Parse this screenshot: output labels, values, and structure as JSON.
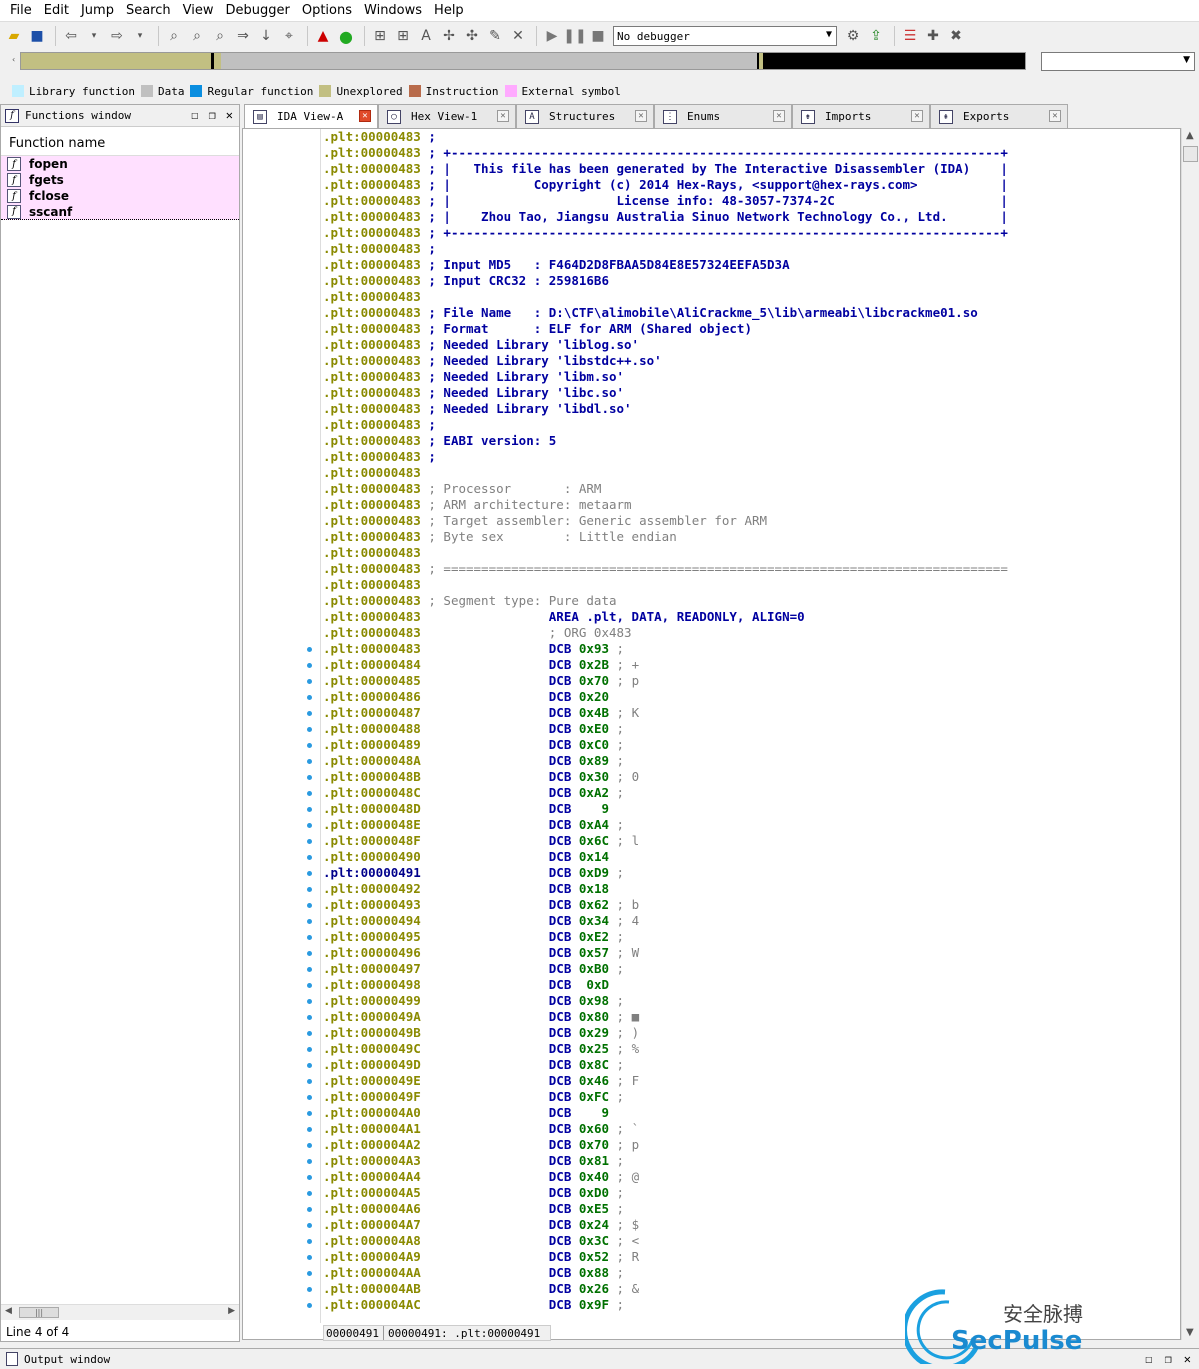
{
  "menu": [
    "File",
    "Edit",
    "Jump",
    "Search",
    "View",
    "Debugger",
    "Options",
    "Windows",
    "Help"
  ],
  "toolbar": {
    "debugger_select": "No debugger"
  },
  "legend": [
    {
      "label": "Library function",
      "color": "#bfefff"
    },
    {
      "label": "Data",
      "color": "#c0c0c0"
    },
    {
      "label": "Regular function",
      "color": "#0a8ee0"
    },
    {
      "label": "Unexplored",
      "color": "#c2bf82"
    },
    {
      "label": "Instruction",
      "color": "#b86b4b"
    },
    {
      "label": "External symbol",
      "color": "#ffaaff"
    }
  ],
  "functions_window": {
    "title": "Functions window",
    "column_header": "Function name",
    "items": [
      "fopen",
      "fgets",
      "fclose",
      "sscanf"
    ],
    "status": "Line 4 of 4"
  },
  "tabs": [
    "IDA View-A",
    "Hex View-1",
    "Structures",
    "Enums",
    "Imports",
    "Exports"
  ],
  "header_lines": [
    {
      "addr": ".plt:00000483",
      "text": " ;",
      "style": "blue"
    },
    {
      "addr": ".plt:00000483",
      "text": " ; +-------------------------------------------------------------------------+",
      "style": "blue"
    },
    {
      "addr": ".plt:00000483",
      "text": " ; |   This file has been generated by The Interactive Disassembler (IDA)    |",
      "style": "blue"
    },
    {
      "addr": ".plt:00000483",
      "text": " ; |           Copyright (c) 2014 Hex-Rays, <support@hex-rays.com>           |",
      "style": "blue"
    },
    {
      "addr": ".plt:00000483",
      "text": " ; |                      License info: 48-3057-7374-2C                      |",
      "style": "blue"
    },
    {
      "addr": ".plt:00000483",
      "text": " ; |    Zhou Tao, Jiangsu Australia Sinuo Network Technology Co., Ltd.       |",
      "style": "blue"
    },
    {
      "addr": ".plt:00000483",
      "text": " ; +-------------------------------------------------------------------------+",
      "style": "blue"
    },
    {
      "addr": ".plt:00000483",
      "text": " ;",
      "style": "blue"
    },
    {
      "addr": ".plt:00000483",
      "text": " ; Input MD5   : F464D2D8FBAA5D84E8E57324EEFA5D3A",
      "style": "blue"
    },
    {
      "addr": ".plt:00000483",
      "text": " ; Input CRC32 : 259816B6",
      "style": "blue"
    },
    {
      "addr": ".plt:00000483",
      "text": "",
      "style": "blue"
    },
    {
      "addr": ".plt:00000483",
      "text": " ; File Name   : D:\\CTF\\alimobile\\AliCrackme_5\\lib\\armeabi\\libcrackme01.so",
      "style": "blue"
    },
    {
      "addr": ".plt:00000483",
      "text": " ; Format      : ELF for ARM (Shared object)",
      "style": "blue"
    },
    {
      "addr": ".plt:00000483",
      "text": " ; Needed Library 'liblog.so'",
      "style": "blue"
    },
    {
      "addr": ".plt:00000483",
      "text": " ; Needed Library 'libstdc++.so'",
      "style": "blue"
    },
    {
      "addr": ".plt:00000483",
      "text": " ; Needed Library 'libm.so'",
      "style": "blue"
    },
    {
      "addr": ".plt:00000483",
      "text": " ; Needed Library 'libc.so'",
      "style": "blue"
    },
    {
      "addr": ".plt:00000483",
      "text": " ; Needed Library 'libdl.so'",
      "style": "blue"
    },
    {
      "addr": ".plt:00000483",
      "text": " ;",
      "style": "blue"
    },
    {
      "addr": ".plt:00000483",
      "text": " ; EABI version: 5",
      "style": "blue"
    },
    {
      "addr": ".plt:00000483",
      "text": " ;",
      "style": "blue"
    },
    {
      "addr": ".plt:00000483",
      "text": "",
      "style": "blue"
    },
    {
      "addr": ".plt:00000483",
      "text": " ; Processor       : ARM",
      "style": "gray"
    },
    {
      "addr": ".plt:00000483",
      "text": " ; ARM architecture: metaarm",
      "style": "gray"
    },
    {
      "addr": ".plt:00000483",
      "text": " ; Target assembler: Generic assembler for ARM",
      "style": "gray"
    },
    {
      "addr": ".plt:00000483",
      "text": " ; Byte sex        : Little endian",
      "style": "gray"
    },
    {
      "addr": ".plt:00000483",
      "text": "",
      "style": "gray"
    },
    {
      "addr": ".plt:00000483",
      "text": " ; ===========================================================================",
      "style": "gray"
    },
    {
      "addr": ".plt:00000483",
      "text": "",
      "style": "gray"
    },
    {
      "addr": ".plt:00000483",
      "text": " ; Segment type: Pure data",
      "style": "gray"
    },
    {
      "addr": ".plt:00000483",
      "text": "                 AREA .plt, DATA, READONLY, ALIGN=0",
      "style": "blue"
    },
    {
      "addr": ".plt:00000483",
      "text": "                 ; ORG 0x483",
      "style": "gray"
    }
  ],
  "data_lines": [
    {
      "addr": ".plt:00000483",
      "val": "0x93",
      "cmt": " ;"
    },
    {
      "addr": ".plt:00000484",
      "val": "0x2B",
      "cmt": " ; +"
    },
    {
      "addr": ".plt:00000485",
      "val": "0x70",
      "cmt": " ; p"
    },
    {
      "addr": ".plt:00000486",
      "val": "0x20",
      "cmt": ""
    },
    {
      "addr": ".plt:00000487",
      "val": "0x4B",
      "cmt": " ; K"
    },
    {
      "addr": ".plt:00000488",
      "val": "0xE0",
      "cmt": " ;"
    },
    {
      "addr": ".plt:00000489",
      "val": "0xC0",
      "cmt": " ;"
    },
    {
      "addr": ".plt:0000048A",
      "val": "0x89",
      "cmt": " ;"
    },
    {
      "addr": ".plt:0000048B",
      "val": "0x30",
      "cmt": " ; 0"
    },
    {
      "addr": ".plt:0000048C",
      "val": "0xA2",
      "cmt": " ;"
    },
    {
      "addr": ".plt:0000048D",
      "val": "   9",
      "cmt": ""
    },
    {
      "addr": ".plt:0000048E",
      "val": "0xA4",
      "cmt": " ;"
    },
    {
      "addr": ".plt:0000048F",
      "val": "0x6C",
      "cmt": " ; l"
    },
    {
      "addr": ".plt:00000490",
      "val": "0x14",
      "cmt": ""
    },
    {
      "addr": ".plt:00000491",
      "val": "0xD9",
      "cmt": " ;"
    },
    {
      "addr": ".plt:00000492",
      "val": "0x18",
      "cmt": ""
    },
    {
      "addr": ".plt:00000493",
      "val": "0x62",
      "cmt": " ; b"
    },
    {
      "addr": ".plt:00000494",
      "val": "0x34",
      "cmt": " ; 4"
    },
    {
      "addr": ".plt:00000495",
      "val": "0xE2",
      "cmt": " ;"
    },
    {
      "addr": ".plt:00000496",
      "val": "0x57",
      "cmt": " ; W"
    },
    {
      "addr": ".plt:00000497",
      "val": "0xB0",
      "cmt": " ;"
    },
    {
      "addr": ".plt:00000498",
      "val": " 0xD",
      "cmt": ""
    },
    {
      "addr": ".plt:00000499",
      "val": "0x98",
      "cmt": " ;"
    },
    {
      "addr": ".plt:0000049A",
      "val": "0x80",
      "cmt": " ; ■"
    },
    {
      "addr": ".plt:0000049B",
      "val": "0x29",
      "cmt": " ; )"
    },
    {
      "addr": ".plt:0000049C",
      "val": "0x25",
      "cmt": " ; %"
    },
    {
      "addr": ".plt:0000049D",
      "val": "0x8C",
      "cmt": " ;"
    },
    {
      "addr": ".plt:0000049E",
      "val": "0x46",
      "cmt": " ; F"
    },
    {
      "addr": ".plt:0000049F",
      "val": "0xFC",
      "cmt": " ;"
    },
    {
      "addr": ".plt:000004A0",
      "val": "   9",
      "cmt": ""
    },
    {
      "addr": ".plt:000004A1",
      "val": "0x60",
      "cmt": " ; `"
    },
    {
      "addr": ".plt:000004A2",
      "val": "0x70",
      "cmt": " ; p"
    },
    {
      "addr": ".plt:000004A3",
      "val": "0x81",
      "cmt": " ;"
    },
    {
      "addr": ".plt:000004A4",
      "val": "0x40",
      "cmt": " ; @"
    },
    {
      "addr": ".plt:000004A5",
      "val": "0xD0",
      "cmt": " ;"
    },
    {
      "addr": ".plt:000004A6",
      "val": "0xE5",
      "cmt": " ;"
    },
    {
      "addr": ".plt:000004A7",
      "val": "0x24",
      "cmt": " ; $"
    },
    {
      "addr": ".plt:000004A8",
      "val": "0x3C",
      "cmt": " ; <"
    },
    {
      "addr": ".plt:000004A9",
      "val": "0x52",
      "cmt": " ; R"
    },
    {
      "addr": ".plt:000004AA",
      "val": "0x88",
      "cmt": " ;"
    },
    {
      "addr": ".plt:000004AB",
      "val": "0x26",
      "cmt": " ; &"
    },
    {
      "addr": ".plt:000004AC",
      "val": "0x9F",
      "cmt": " ;"
    }
  ],
  "directive": "DCB",
  "current_address": ".plt:00000491",
  "status_bar": {
    "offset": "00000491",
    "location": "00000491: .plt:00000491"
  },
  "output_window": {
    "title": "Output window"
  },
  "watermark": {
    "cn": "安全脉搏",
    "en": "SecPulse"
  }
}
